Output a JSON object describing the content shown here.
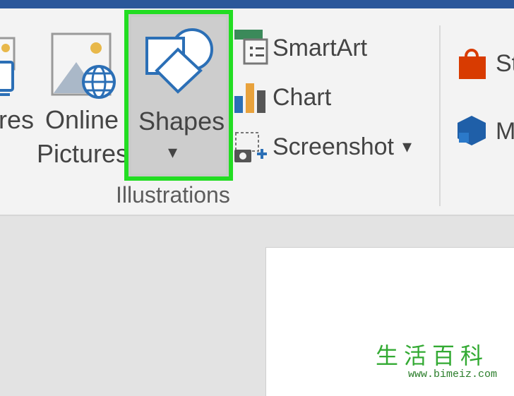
{
  "ribbon": {
    "pictures_label_partial": "res",
    "online_pictures": {
      "line1": "Online",
      "line2": "Pictures"
    },
    "shapes": {
      "label": "Shapes",
      "dropdown_arrow": "▾"
    },
    "smartart": {
      "label": "SmartArt",
      "icon": "smartart-icon"
    },
    "chart": {
      "label": "Chart",
      "icon": "chart-icon"
    },
    "screenshot": {
      "label": "Screenshot",
      "dropdown_arrow": "▾",
      "icon": "screenshot-icon"
    },
    "group_label": "Illustrations",
    "store_partial": "St",
    "myaddins_partial": "M"
  },
  "colors": {
    "highlight": "#22dd22",
    "title_bar": "#2b579a",
    "icon_blue": "#2b6fb6",
    "store_red": "#d83b01"
  },
  "watermark": {
    "chars": [
      "生",
      "活",
      "百",
      "科"
    ],
    "url": "www.bimeiz.com"
  }
}
